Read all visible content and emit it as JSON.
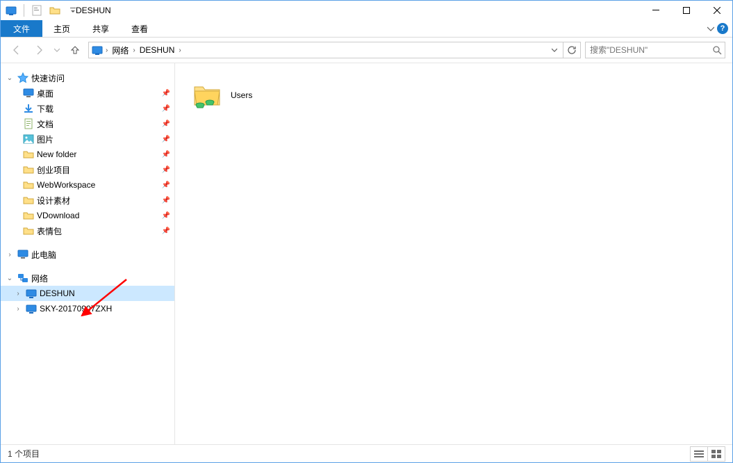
{
  "title": "DESHUN",
  "ribbon": {
    "file_label": "文件",
    "tabs": [
      "主页",
      "共享",
      "查看"
    ]
  },
  "nav": {
    "breadcrumbs": [
      "网络",
      "DESHUN"
    ]
  },
  "search": {
    "placeholder": "搜索\"DESHUN\""
  },
  "tree": {
    "quick_access": {
      "label": "快速访问",
      "items": [
        {
          "label": "桌面",
          "icon": "desktop",
          "pinned": true
        },
        {
          "label": "下载",
          "icon": "downloads",
          "pinned": true
        },
        {
          "label": "文档",
          "icon": "documents",
          "pinned": true
        },
        {
          "label": "图片",
          "icon": "pictures",
          "pinned": true
        },
        {
          "label": "New folder",
          "icon": "folder",
          "pinned": true
        },
        {
          "label": "创业项目",
          "icon": "folder",
          "pinned": true
        },
        {
          "label": "WebWorkspace",
          "icon": "folder",
          "pinned": true
        },
        {
          "label": "设计素材",
          "icon": "folder",
          "pinned": true
        },
        {
          "label": "VDownload",
          "icon": "folder",
          "pinned": true
        },
        {
          "label": "表情包",
          "icon": "folder",
          "pinned": true
        }
      ]
    },
    "this_pc": {
      "label": "此电脑"
    },
    "network": {
      "label": "网络",
      "items": [
        {
          "label": "DESHUN",
          "selected": true
        },
        {
          "label": "SKY-20170907ZXH",
          "selected": false
        }
      ]
    }
  },
  "content": {
    "items": [
      {
        "label": "Users",
        "icon": "shared-folder"
      }
    ]
  },
  "status": {
    "text": "1 个项目"
  }
}
